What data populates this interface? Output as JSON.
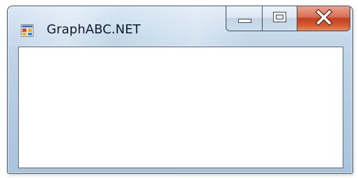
{
  "window": {
    "title": "GraphABC.NET",
    "icon": "app-window-icon"
  },
  "caption_buttons": {
    "minimize_icon": "minimize-icon",
    "maximize_icon": "maximize-icon",
    "close_icon": "close-icon"
  },
  "colors": {
    "frame": "#b7cde3",
    "close_button": "#c2411f",
    "client_background": "#ffffff"
  }
}
